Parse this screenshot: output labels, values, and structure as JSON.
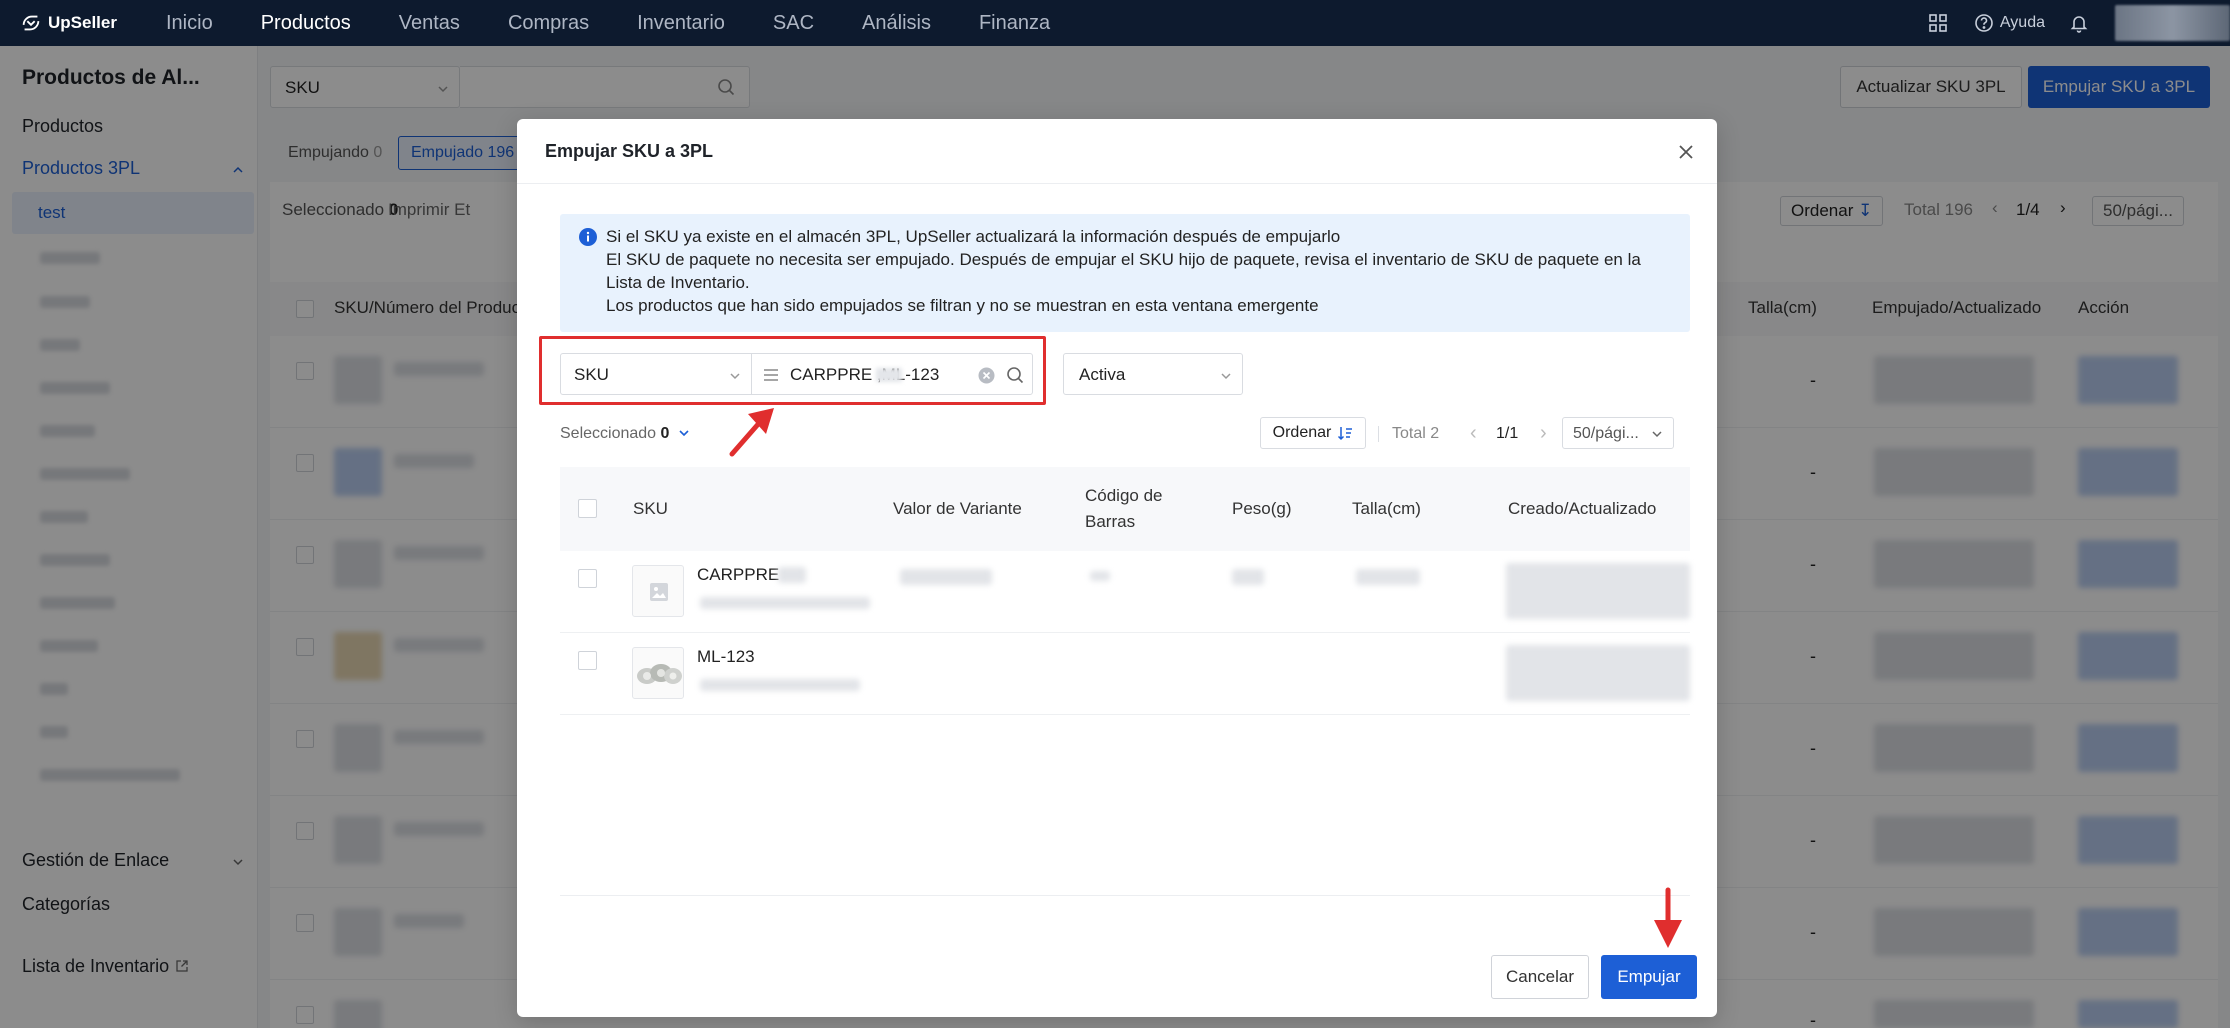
{
  "app": {
    "brand": "UpSeller",
    "nav": [
      "Inicio",
      "Productos",
      "Ventas",
      "Compras",
      "Inventario",
      "SAC",
      "Análisis",
      "Finanza"
    ],
    "active_nav": "Productos",
    "help": "Ayuda"
  },
  "sidebar": {
    "title": "Productos de Al...",
    "items": {
      "productos": "Productos",
      "productos_3pl": "Productos 3PL",
      "test": "test",
      "gestion": "Gestión de Enlace",
      "categorias": "Categorías",
      "lista": "Lista de Inventario"
    }
  },
  "background": {
    "search_type": "SKU",
    "btn_update": "Actualizar SKU 3PL",
    "btn_push": "Empujar SKU a 3PL",
    "tab_pushing": "Empujando",
    "tab_pushing_count": "0",
    "tab_pushed": "Empujado",
    "tab_pushed_count": "196",
    "selected_label": "Seleccionado",
    "selected_count": "0",
    "print": "Imprimir Et",
    "sort": "Ordenar",
    "total": "Total 196",
    "page": "1/4",
    "page_size": "50/pági...",
    "col_sku": "SKU/Número del Produc",
    "col_size": "Talla(cm)",
    "col_pushed": "Empujado/Actualizado",
    "col_action": "Acción",
    "dash": "-"
  },
  "modal": {
    "title": "Empujar SKU a 3PL",
    "info_lines": [
      "Si el SKU ya existe en el almacén 3PL, UpSeller actualizará la información después de empujarlo",
      "El SKU de paquete no necesita ser empujado. Después de empujar el SKU hijo de paquete, revisa el inventario de SKU de paquete en la",
      "Lista de Inventario.",
      "Los productos que han sido empujados se filtran y no se muestran en esta ventana emergente"
    ],
    "filter_type": "SKU",
    "search_value": "CARPPRE      ,ML-123",
    "status": "Activa",
    "selected_label": "Seleccionado",
    "selected_count": "0",
    "sort": "Ordenar",
    "total": "Total 2",
    "page": "1/1",
    "page_size": "50/pági...",
    "columns": {
      "sku": "SKU",
      "variant": "Valor de Variante",
      "barcode_1": "Código de",
      "barcode_2": "Barras",
      "weight": "Peso(g)",
      "size": "Talla(cm)",
      "created": "Creado/Actualizado"
    },
    "rows": [
      {
        "sku": "CARPPRE"
      },
      {
        "sku": "ML-123"
      }
    ],
    "cancel": "Cancelar",
    "push": "Empujar"
  },
  "colors": {
    "primary": "#1d5fd6",
    "topbar": "#0d1a2e",
    "highlight": "#e02e2e",
    "info_bg": "#e8f2fd"
  }
}
